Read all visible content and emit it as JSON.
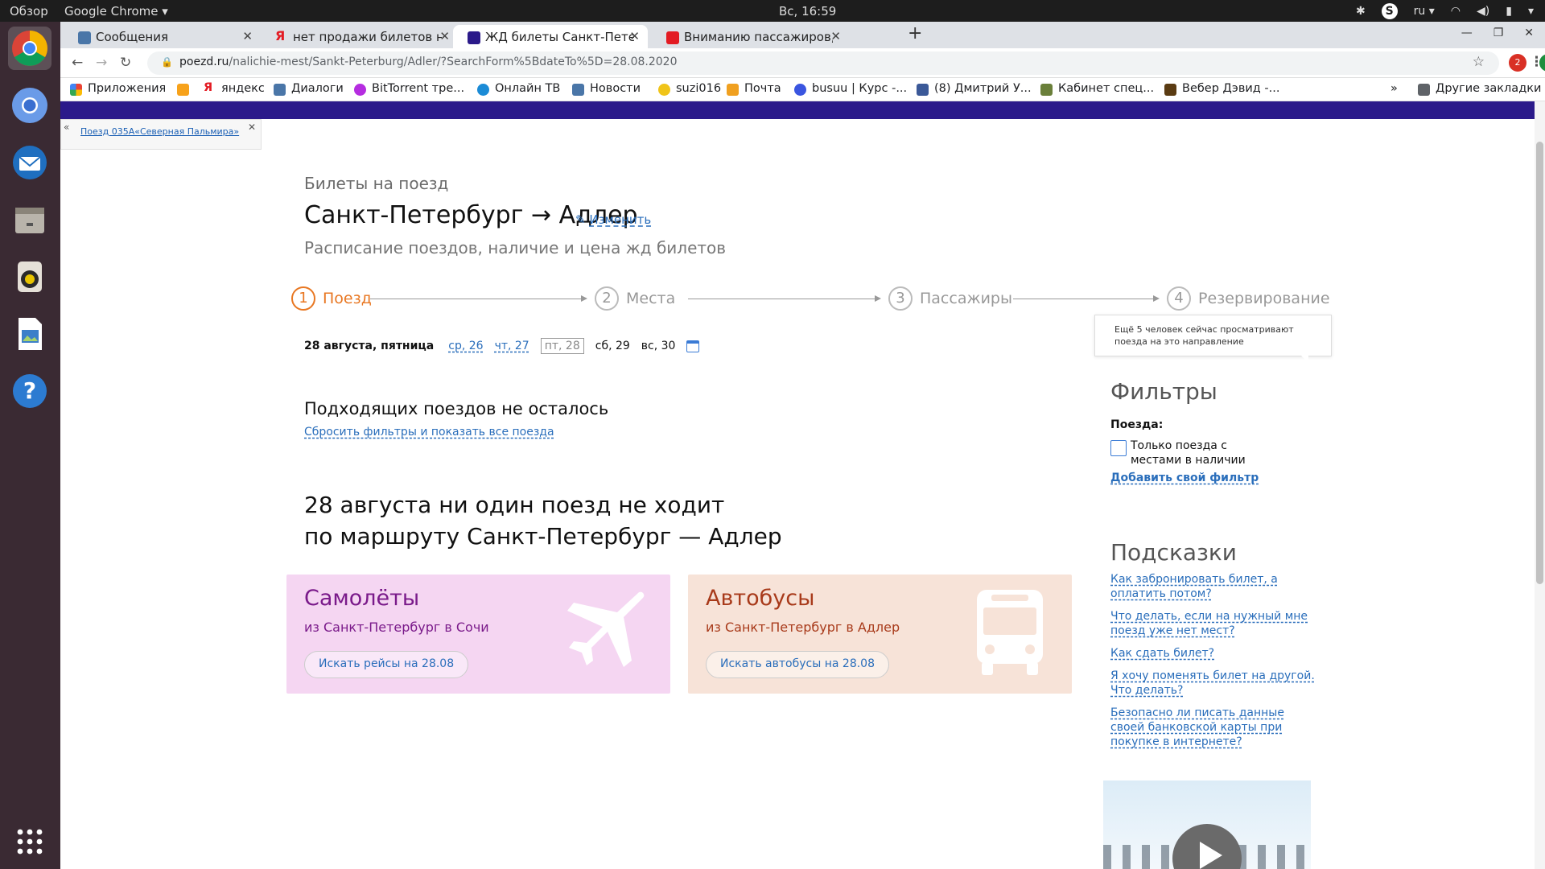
{
  "system": {
    "overview": "Обзор",
    "app_name": "Google Chrome",
    "clock": "Вс, 16:59",
    "lang": "ru"
  },
  "tabs": [
    {
      "title": "Сообщения",
      "color": "#4a76a8"
    },
    {
      "title": "нет продажи билетов на",
      "color": "#e31b23"
    },
    {
      "title": "ЖД билеты Санкт-Петербург",
      "color": "#2b1a8a",
      "active": true
    },
    {
      "title": "Вниманию пассажиров, ",
      "color": "#e31b23"
    }
  ],
  "address": {
    "domain": "poezd.ru",
    "path": "/nalichie-mest/Sankt-Peterburg/Adler/?SearchForm%5BdateTo%5D=28.08.2020",
    "ext_badge": "2",
    "profile": "E"
  },
  "bookmarks": [
    {
      "label": "Приложения",
      "color": "#4285f4"
    },
    {
      "label": "",
      "color": "#f7a21b"
    },
    {
      "label": "яндекс",
      "color": "#e31b23"
    },
    {
      "label": "Диалоги",
      "color": "#4a76a8"
    },
    {
      "label": "BitTorrent тре...",
      "color": "#b52de0"
    },
    {
      "label": "Онлайн ТВ",
      "color": "#1b8bd6"
    },
    {
      "label": "Новости",
      "color": "#4a76a8"
    },
    {
      "label": "suzi016",
      "color": "#f0c419"
    },
    {
      "label": "Почта",
      "color": "#f0a020"
    },
    {
      "label": "busuu | Курс -...",
      "color": "#3a55e0"
    },
    {
      "label": "(8) Дмитрий У...",
      "color": "#3b5998"
    },
    {
      "label": "Кабинет спец...",
      "color": "#6a7f3a"
    },
    {
      "label": "Вебер Дэвид -...",
      "color": "#5a3b12"
    }
  ],
  "bookmarks_more": "»",
  "bookmarks_other": "Другие закладки",
  "sidebar_link": "Поезд 035А«Северная Пальмира»",
  "page": {
    "kicker": "Билеты на поезд",
    "route": "Санкт-Петербург → Адлер",
    "edit": "Изменить",
    "subtitle": "Расписание поездов, наличие и цена жд билетов"
  },
  "steps": [
    {
      "num": "1",
      "label": "Поезд",
      "current": true
    },
    {
      "num": "2",
      "label": "Места"
    },
    {
      "num": "3",
      "label": "Пассажиры"
    },
    {
      "num": "4",
      "label": "Резервирование"
    }
  ],
  "dates": {
    "current": "28 августа, пятница",
    "items": [
      "ср, 26",
      "чт, 27",
      "пт, 28",
      "сб, 29",
      "вс, 30"
    ]
  },
  "tooltip": "Ещё 5 человек сейчас просматривают поезда на это направление",
  "nomatch": {
    "title": "Подходящих поездов не осталось",
    "reset": "Сбросить фильтры и показать все поезда"
  },
  "notrains": {
    "line1": "28 августа ни один поезд не ходит",
    "line2": "по маршруту Санкт-Петербург — Адлер"
  },
  "cards": [
    {
      "title": "Самолёты",
      "sub": "из Санкт-Петербург в Сочи",
      "button": "Искать рейсы на 28.08",
      "bg": "#f5d6f2",
      "fg": "#7a1a8a"
    },
    {
      "title": "Автобусы",
      "sub": "из Санкт-Петербург в Адлер",
      "button": "Искать автобусы на 28.08",
      "bg": "#f7e3d8",
      "fg": "#a83a1a"
    }
  ],
  "filters": {
    "title": "Фильтры",
    "label": "Поезда:",
    "checkbox": "Только поезда с местами в наличии",
    "add": "Добавить свой фильтр"
  },
  "hints": {
    "title": "Подсказки",
    "items": [
      "Как забронировать билет, а оплатить потом?",
      "Что делать, если на нужный мне поезд уже нет мест?",
      "Как сдать билет?",
      "Я хочу поменять билет на другой. Что делать?",
      "Безопасно ли писать данные своей банковской карты при покупке в интернете?"
    ]
  }
}
